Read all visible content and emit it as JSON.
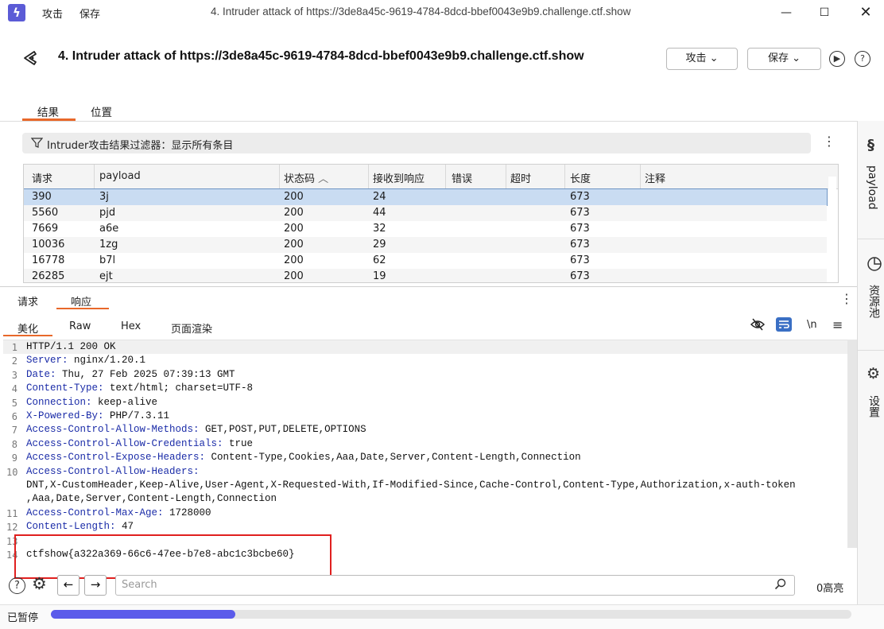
{
  "window": {
    "menu": [
      "攻击",
      "保存"
    ],
    "title": "4. Intruder attack of https://3de8a45c-9619-4784-8dcd-bbef0043e9b9.challenge.ctf.show"
  },
  "header": {
    "title": "4. Intruder attack of https://3de8a45c-9619-4784-8dcd-bbef0043e9b9.challenge.ctf.show",
    "attack_btn": "攻击",
    "save_btn": "保存"
  },
  "tabs": [
    "结果",
    "位置"
  ],
  "filter": {
    "text": "Intruder攻击结果过滤器：显示所有条目"
  },
  "table": {
    "columns": [
      "请求",
      "payload",
      "状态码",
      "接收到响应",
      "错误",
      "超时",
      "长度",
      "注释"
    ],
    "rows": [
      [
        "390",
        "3j",
        "200",
        "24",
        "",
        "",
        "673",
        ""
      ],
      [
        "5560",
        "pjd",
        "200",
        "44",
        "",
        "",
        "673",
        ""
      ],
      [
        "7669",
        "a6e",
        "200",
        "32",
        "",
        "",
        "673",
        ""
      ],
      [
        "10036",
        "1zg",
        "200",
        "29",
        "",
        "",
        "673",
        ""
      ],
      [
        "16778",
        "b7l",
        "200",
        "62",
        "",
        "",
        "673",
        ""
      ],
      [
        "26285",
        "ejt",
        "200",
        "19",
        "",
        "",
        "673",
        ""
      ]
    ],
    "sort_indicator": "^"
  },
  "sidebar": [
    "payload",
    "资源池",
    "设置"
  ],
  "rr_tabs": [
    "请求",
    "响应"
  ],
  "view_tabs": [
    "美化",
    "Raw",
    "Hex",
    "页面渲染"
  ],
  "view_icons": {
    "newline": "\\n"
  },
  "response": {
    "lines": [
      {
        "n": "1",
        "key": "",
        "val": "HTTP/1.1 200 OK"
      },
      {
        "n": "2",
        "key": "Server:",
        "val": " nginx/1.20.1"
      },
      {
        "n": "3",
        "key": "Date:",
        "val": " Thu, 27 Feb 2025 07:39:13 GMT"
      },
      {
        "n": "4",
        "key": "Content-Type:",
        "val": " text/html; charset=UTF-8"
      },
      {
        "n": "5",
        "key": "Connection:",
        "val": " keep-alive"
      },
      {
        "n": "6",
        "key": "X-Powered-By:",
        "val": " PHP/7.3.11"
      },
      {
        "n": "7",
        "key": "Access-Control-Allow-Methods:",
        "val": " GET,POST,PUT,DELETE,OPTIONS"
      },
      {
        "n": "8",
        "key": "Access-Control-Allow-Credentials:",
        "val": " true"
      },
      {
        "n": "9",
        "key": "Access-Control-Expose-Headers:",
        "val": " Content-Type,Cookies,Aaa,Date,Server,Content-Length,Connection"
      },
      {
        "n": "10",
        "key": "Access-Control-Allow-Headers:",
        "val": ""
      },
      {
        "n": "",
        "key": "",
        "val": "DNT,X-CustomHeader,Keep-Alive,User-Agent,X-Requested-With,If-Modified-Since,Cache-Control,Content-Type,Authorization,x-auth-token"
      },
      {
        "n": "",
        "key": "",
        "val": ",Aaa,Date,Server,Content-Length,Connection"
      },
      {
        "n": "11",
        "key": "Access-Control-Max-Age:",
        "val": " 1728000"
      },
      {
        "n": "12",
        "key": "Content-Length:",
        "val": " 47"
      },
      {
        "n": "13",
        "key": "",
        "val": ""
      },
      {
        "n": "14",
        "key": "",
        "val": "ctfshow{a322a369-66c6-47ee-b7e8-abc1c3bcbe60}"
      }
    ]
  },
  "search": {
    "placeholder": "Search",
    "highlights": "0高亮"
  },
  "status": {
    "text": "已暂停",
    "progress": 0.23,
    "accent": "#5b5bea"
  },
  "colors": {
    "highlight_box": "#e0201f",
    "tab_underline": "#e8682a",
    "selected_row": "#c9dcf2"
  }
}
